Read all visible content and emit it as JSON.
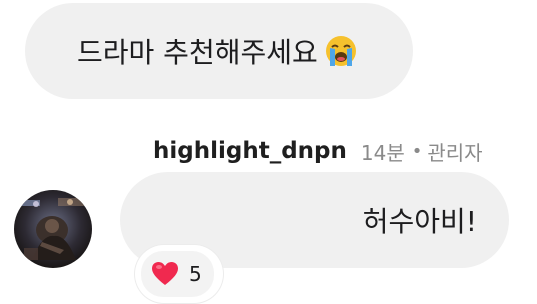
{
  "comment": {
    "text": "드라마 추천해주세요",
    "emoji": "loudly-crying-face-icon"
  },
  "reply": {
    "username": "highlight_dnpn",
    "time": "14분",
    "separator": "•",
    "role": "관리자",
    "text": "허수아비!",
    "reaction": {
      "icon": "heart-icon",
      "count": "5",
      "color": "#f0294f"
    }
  }
}
